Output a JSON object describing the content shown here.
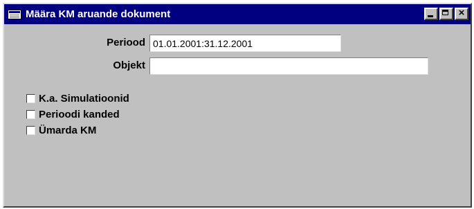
{
  "window": {
    "title": "Määra KM aruande dokument",
    "icon": "window-menu-icon",
    "controls": {
      "close_glyph": "×"
    }
  },
  "form": {
    "period_label": "Periood",
    "period_value": "01.01.2001:31.12.2001",
    "object_label": "Objekt",
    "object_value": ""
  },
  "options": [
    {
      "label": "K.a. Simulatioonid",
      "checked": false
    },
    {
      "label": "Perioodi kanded",
      "checked": false
    },
    {
      "label": "Ümarda KM",
      "checked": false
    }
  ],
  "colors": {
    "titlebar": "#000080",
    "face": "#c0c0c0"
  }
}
